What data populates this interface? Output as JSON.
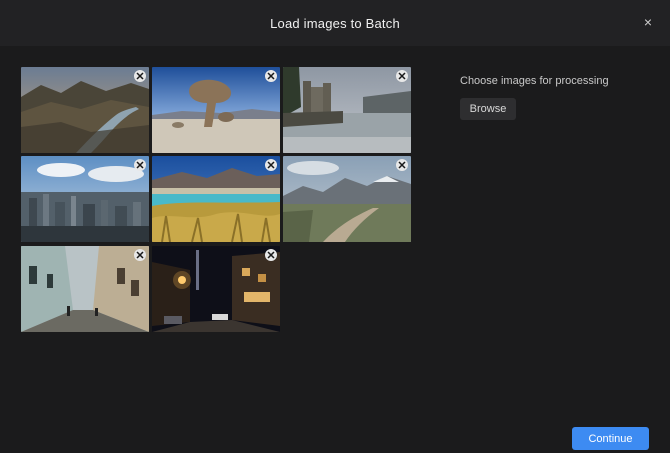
{
  "dialog": {
    "title": "Load images to Batch",
    "close_glyph": "×"
  },
  "panel": {
    "label": "Choose images for processing",
    "browse_label": "Browse"
  },
  "footer": {
    "continue_label": "Continue"
  },
  "thumbnails": [
    {
      "name": "mountain-valley-river",
      "icon": "remove-icon"
    },
    {
      "name": "desert-rock-formation",
      "icon": "remove-icon"
    },
    {
      "name": "lakeside-castle",
      "icon": "remove-icon"
    },
    {
      "name": "city-skyline",
      "icon": "remove-icon"
    },
    {
      "name": "lagoon-grassland",
      "icon": "remove-icon"
    },
    {
      "name": "mountain-road",
      "icon": "remove-icon"
    },
    {
      "name": "old-town-street",
      "icon": "remove-icon"
    },
    {
      "name": "night-street",
      "icon": "remove-icon"
    }
  ],
  "colors": {
    "accent": "#3d8bf2",
    "background": "#1b1b1c",
    "header": "#222224"
  }
}
